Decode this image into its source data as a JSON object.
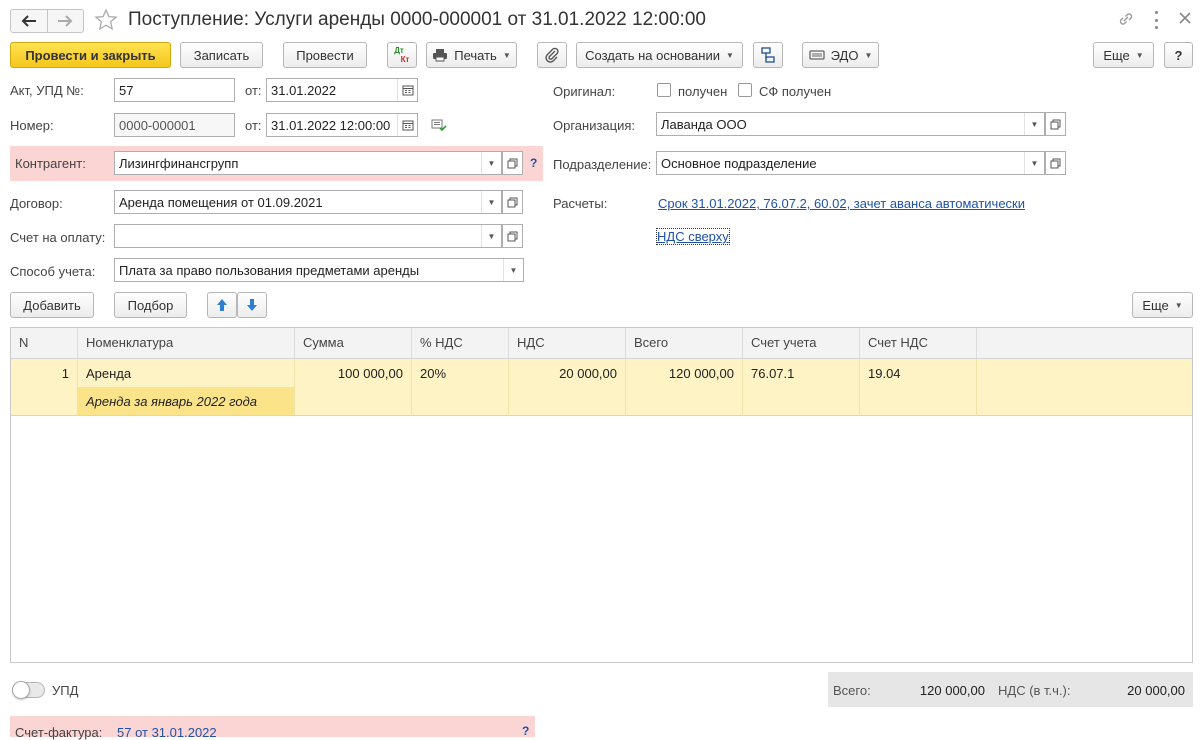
{
  "window": {
    "title": "Поступление: Услуги аренды 0000-000001 от 31.01.2022 12:00:00"
  },
  "toolbar": {
    "post_close": "Провести и закрыть",
    "save": "Записать",
    "post": "Провести",
    "dtkt_top": "Дт",
    "dtkt_bottom": "Кт",
    "print": "Печать",
    "create_based": "Создать на основании",
    "edo": "ЭДО",
    "more": "Еще",
    "help": "?"
  },
  "form": {
    "act_label": "Акт, УПД №:",
    "act_number": "57",
    "from_label": "от:",
    "act_date": "31.01.2022",
    "number_label": "Номер:",
    "number_value": "0000-000001",
    "from_label2": "от:",
    "doc_datetime": "31.01.2022 12:00:00",
    "contractor_label": "Контрагент:",
    "contractor_value": "Лизингфинансгрупп",
    "contract_label": "Договор:",
    "contract_value": "Аренда помещения от 01.09.2021",
    "invoice_label": "Счет на оплату:",
    "invoice_value": "",
    "method_label": "Способ учета:",
    "method_value": "Плата за право пользования предметами аренды",
    "original_label": "Оригинал:",
    "received_label": "получен",
    "sf_received_label": "СФ получен",
    "org_label": "Организация:",
    "org_value": "Лаванда ООО",
    "dept_label": "Подразделение:",
    "dept_value": "Основное подразделение",
    "settlements_label": "Расчеты:",
    "settlements_link": "Срок 31.01.2022, 76.07.2, 60.02, зачет аванса автоматически",
    "vat_link": "НДС сверху",
    "help_q": "?"
  },
  "table_toolbar": {
    "add": "Добавить",
    "pick": "Подбор",
    "more": "Еще"
  },
  "table": {
    "columns": [
      "N",
      "Номенклатура",
      "Сумма",
      "% НДС",
      "НДС",
      "Всего",
      "Счет учета",
      "Счет НДС"
    ],
    "rows": [
      {
        "n": "1",
        "item": "Аренда",
        "item_desc": "Аренда за январь 2022 года",
        "sum": "100 000,00",
        "vat_rate": "20%",
        "vat": "20 000,00",
        "total": "120 000,00",
        "account": "76.07.1",
        "vat_account": "19.04"
      }
    ]
  },
  "footer": {
    "upd_label": "УПД",
    "total_label": "Всего:",
    "total_value": "120 000,00",
    "vat_label": "НДС (в т.ч.):",
    "vat_value": "20 000,00",
    "invoice_label": "Счет-фактура:",
    "invoice_link": "57 от 31.01.2022",
    "help_q": "?"
  },
  "colors": {
    "primary_button": "#f5c61a",
    "selected_row": "#fdf3c4",
    "highlight_cell": "#fbe38a",
    "required_field_bg": "#fbd4d4",
    "link": "#1f52a5"
  }
}
